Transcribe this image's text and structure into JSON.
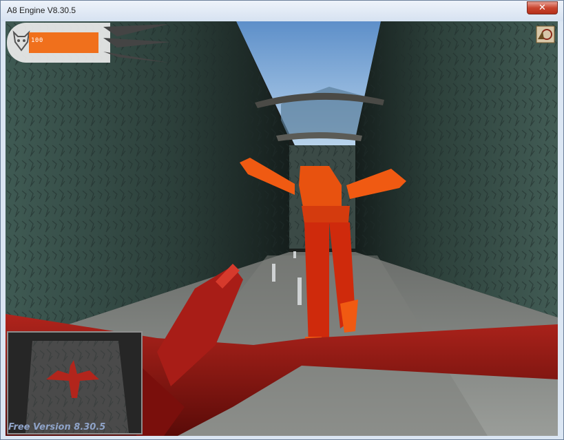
{
  "window": {
    "title": "A8 Engine V8.30.5",
    "close_label": "✕"
  },
  "hud": {
    "health_value": "100",
    "health_fraction": 1.0,
    "bar_color": "#f0701c",
    "icon": "demon-face-icon"
  },
  "overlay": {
    "watermark": "Free Version 8.30.5",
    "engine_logo_icon": "engine-logo-icon"
  },
  "colors": {
    "wall": "#3d5650",
    "sky": "#6fa3d6",
    "enemy": "#f05a12",
    "dragon": "#8c1410"
  }
}
